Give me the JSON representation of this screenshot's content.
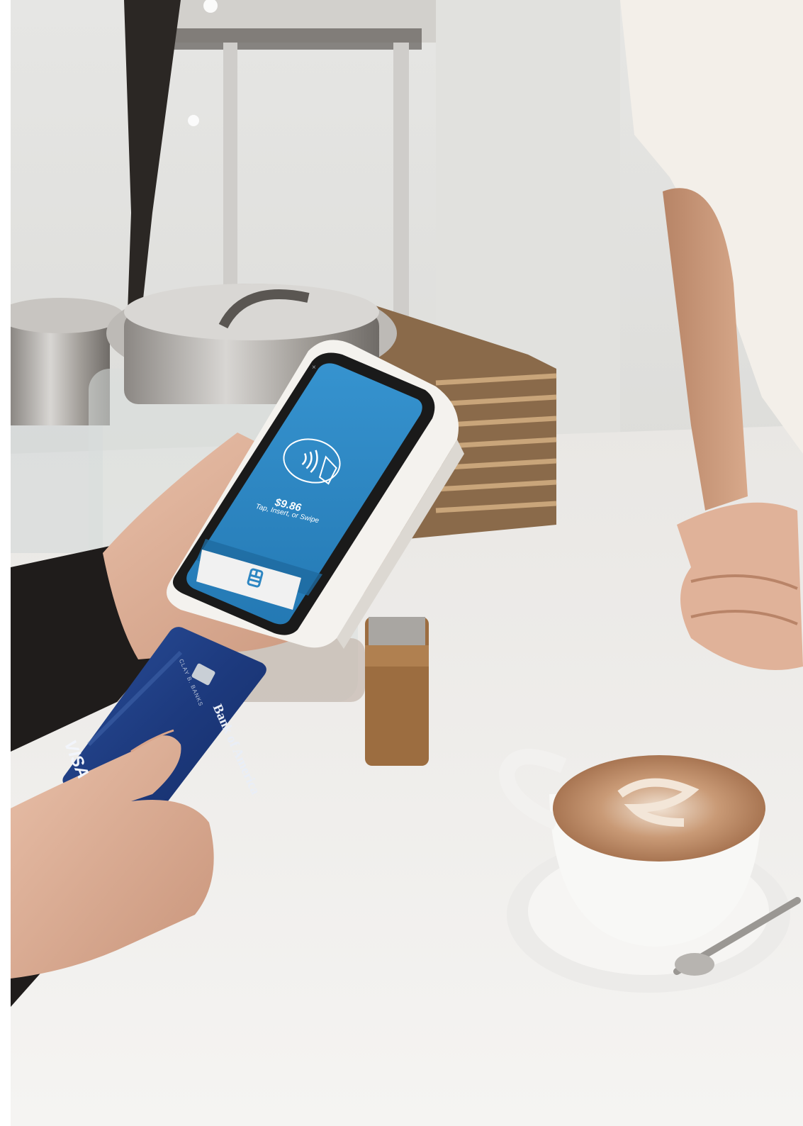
{
  "terminal": {
    "amount": "$9.86",
    "prompt": "Tap, Insert, or Swipe",
    "close_glyph": "×",
    "screen_color": "#2d86c2",
    "icons": [
      "contactless-icon",
      "chip-icon",
      "close-icon"
    ]
  },
  "card": {
    "bank_name": "Bank of America",
    "brand": "VISA",
    "holder": "CLAY B. BANKS",
    "color": "#1f3f86"
  },
  "scene": {
    "objects": [
      "payment-terminal",
      "credit-card",
      "hands",
      "cappuccino-cup",
      "glass-jar",
      "spice-jar",
      "stacked-books",
      "barista"
    ]
  }
}
